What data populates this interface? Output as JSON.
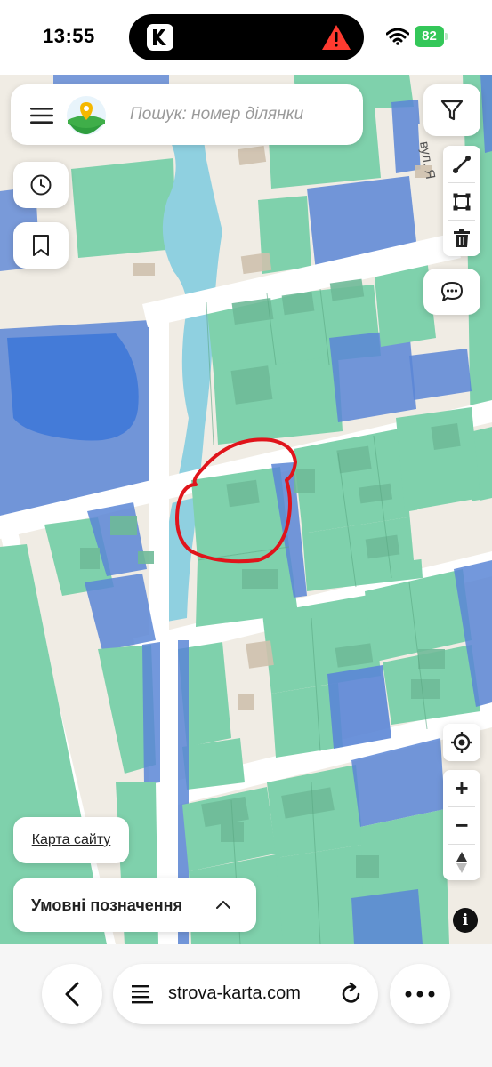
{
  "status": {
    "time": "13:55",
    "battery": "82"
  },
  "search": {
    "placeholder": "Пошук: номер ділянки"
  },
  "map": {
    "street_label": "вул. Я",
    "colors": {
      "background": "#f0ece4",
      "road": "#ffffff",
      "parcel_green": "#7fd1ac",
      "parcel_blue": "#5b86d6",
      "water": "#8fd0e0",
      "building": "#d9c7b3",
      "annotation": "#e0141b"
    }
  },
  "tools": {
    "filter": "filter-icon",
    "history": "clock-icon",
    "bookmark": "bookmark-icon",
    "measure": "ruler-line-icon",
    "area": "polygon-icon",
    "delete": "trash-icon",
    "chat": "chat-icon",
    "locate": "crosshair-icon",
    "zoom_in": "+",
    "zoom_out": "−"
  },
  "buttons": {
    "sitemap": "Карта сайту",
    "legend": "Умовні позначення",
    "info": "i"
  },
  "browser": {
    "url": "strova-karta.com"
  }
}
